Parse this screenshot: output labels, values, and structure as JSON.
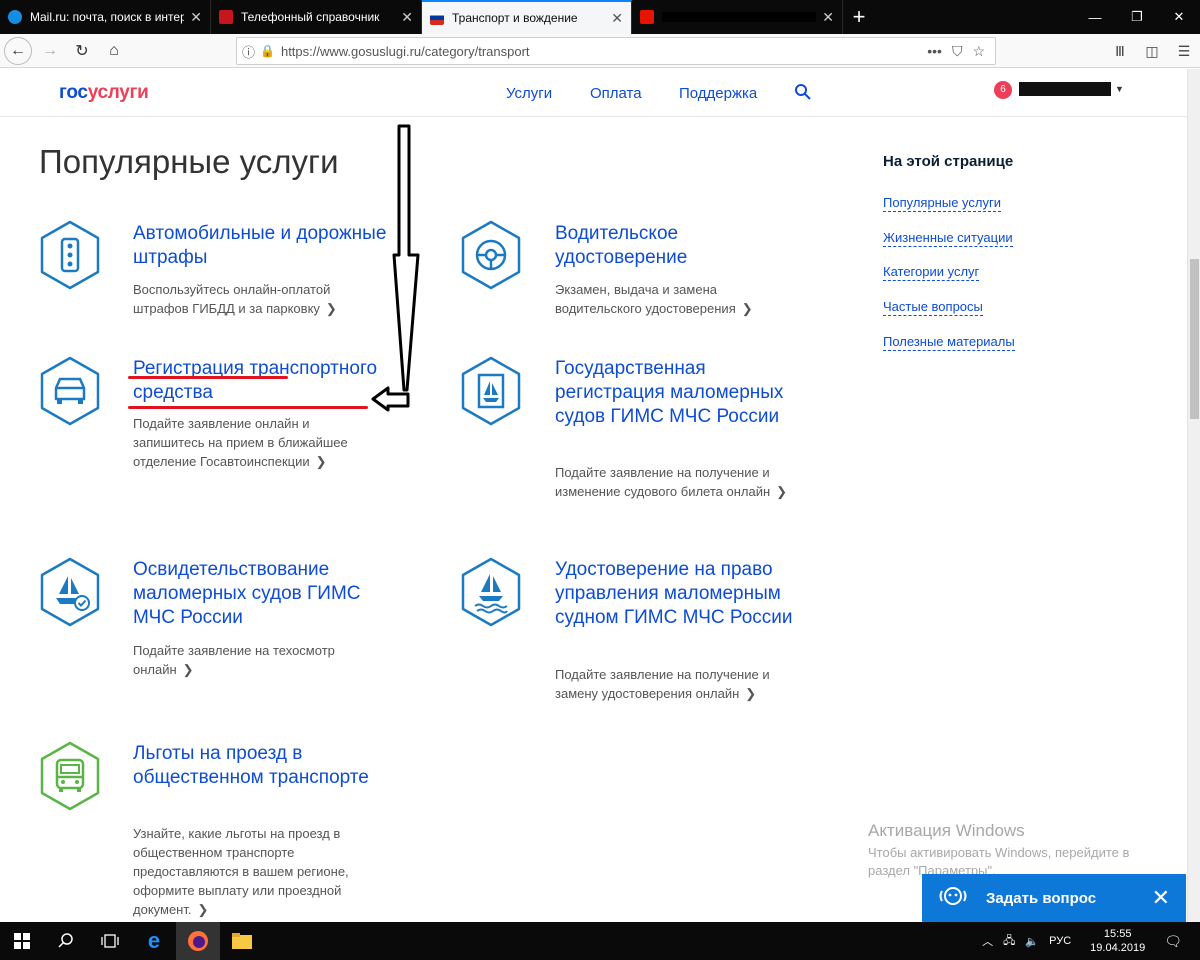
{
  "browser": {
    "tabs": [
      {
        "title": "Mail.ru: почта, поиск в интер",
        "active": false,
        "favicon_color": "#168de2"
      },
      {
        "title": "Телефонный справочник",
        "active": false,
        "favicon_color": "#c4161c"
      },
      {
        "title": "Транспорт и вождение",
        "active": true,
        "favicon_color": "#d52b1e"
      },
      {
        "title": "",
        "active": false,
        "favicon_color": "#e61400"
      }
    ],
    "url": "https://www.gosuslugi.ru/category/transport",
    "new_tab_label": "+"
  },
  "site": {
    "logo_part1": "гос",
    "logo_part2": "услуги",
    "menu": [
      "Услуги",
      "Оплата",
      "Поддержка"
    ],
    "notification_count": "6",
    "brand_color": "#0d4cd3"
  },
  "page": {
    "title": "Популярные услуги",
    "services": [
      {
        "title": "Автомобильные и дорожные штрафы",
        "desc": "Воспользуйтесь онлайн-оплатой штрафов ГИБДД и за парковку",
        "icon": "traffic-light-icon"
      },
      {
        "title": "Водительское удостоверение",
        "desc": "Экзамен, выдача и замена водительского удостоверения",
        "icon": "steering-wheel-icon"
      },
      {
        "title": "Регистрация транспортного средства",
        "desc": "Подайте заявление онлайн и запишитесь на прием в ближайшее отделение Госавтоинспекции",
        "icon": "car-icon"
      },
      {
        "title": "Государственная регистрация маломерных судов ГИМС МЧС России",
        "desc": "Подайте заявление на получение и изменение судового билета онлайн",
        "icon": "boat-document-icon"
      },
      {
        "title": "Освидетельствование маломерных судов ГИМС МЧС России",
        "desc": "Подайте заявление на техосмотр онлайн",
        "icon": "boat-check-icon"
      },
      {
        "title": "Удостоверение на право управления маломерным судном ГИМС МЧС России",
        "desc": "Подайте заявление на получение и замену удостоверения онлайн",
        "icon": "boat-waves-icon"
      },
      {
        "title": "Льготы на проезд в общественном транспорте",
        "desc": "Узнайте, какие льготы на проезд в общественном транспорте предоставляются в вашем регионе, оформите выплату или проездной документ.",
        "icon": "bus-icon"
      }
    ]
  },
  "aside": {
    "title": "На этой странице",
    "links": [
      "Популярные услуги",
      "Жизненные ситуации",
      "Категории услуг",
      "Частые вопросы",
      "Полезные материалы"
    ]
  },
  "watermark": {
    "line1": "Активация Windows",
    "line2": "Чтобы активировать Windows, перейдите в раздел \"Параметры\"."
  },
  "ask": {
    "label": "Задать вопрос"
  },
  "taskbar": {
    "lang": "РУС",
    "time": "15:55",
    "date": "19.04.2019"
  }
}
